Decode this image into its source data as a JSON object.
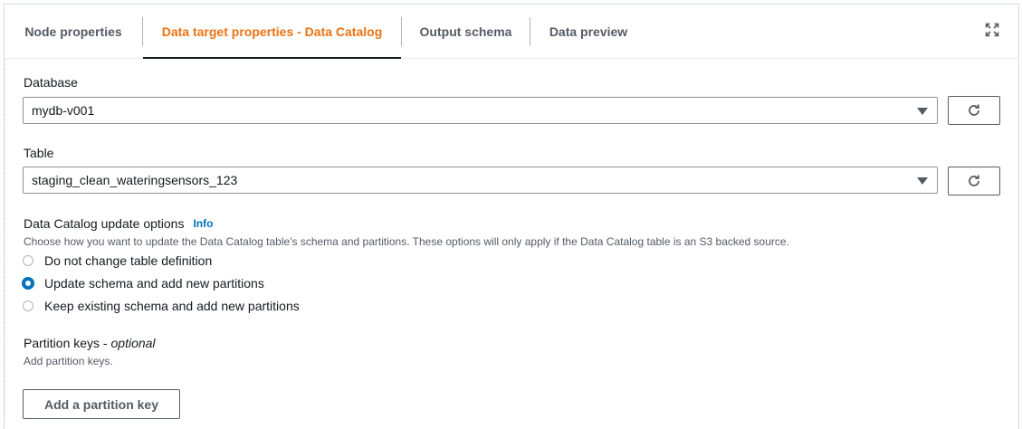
{
  "tabs": [
    {
      "label": "Node properties",
      "active": false
    },
    {
      "label": "Data target properties - Data Catalog",
      "active": true
    },
    {
      "label": "Output schema",
      "active": false
    },
    {
      "label": "Data preview",
      "active": false
    }
  ],
  "database": {
    "label": "Database",
    "value": "mydb-v001"
  },
  "table": {
    "label": "Table",
    "value": "staging_clean_wateringsensors_123"
  },
  "update_options": {
    "title": "Data Catalog update options",
    "info": "Info",
    "description": "Choose how you want to update the Data Catalog table's schema and partitions. These options will only apply if the Data Catalog table is an S3 backed source.",
    "options": [
      {
        "label": "Do not change table definition",
        "selected": false
      },
      {
        "label": "Update schema and add new partitions",
        "selected": true
      },
      {
        "label": "Keep existing schema and add new partitions",
        "selected": false
      }
    ]
  },
  "partition_keys": {
    "title": "Partition keys",
    "optional": "optional",
    "separator": " - ",
    "description": "Add partition keys.",
    "button": "Add a partition key"
  },
  "colors": {
    "accent": "#ec7211",
    "link": "#0073bb",
    "radio_selected": "#0073bb"
  },
  "icons": [
    "expand-icon",
    "refresh-icon",
    "caret-down-icon"
  ]
}
